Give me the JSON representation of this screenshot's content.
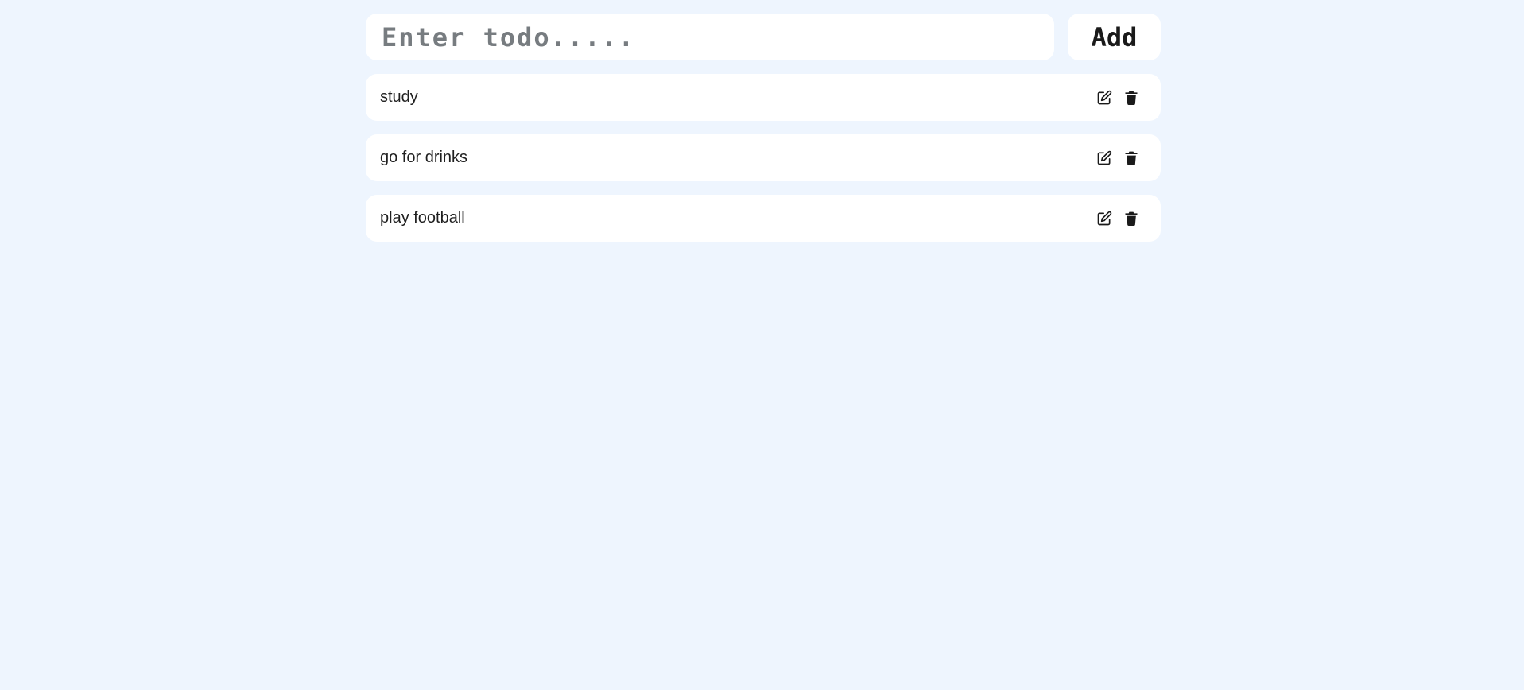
{
  "new_todo": {
    "placeholder": "Enter todo.....",
    "value": ""
  },
  "add_button": {
    "label": "Add"
  },
  "todos": [
    {
      "text": "study",
      "edit_icon": "edit-icon",
      "delete_icon": "trash-icon"
    },
    {
      "text": "go for drinks",
      "edit_icon": "edit-icon",
      "delete_icon": "trash-icon"
    },
    {
      "text": "play football",
      "edit_icon": "edit-icon",
      "delete_icon": "trash-icon"
    }
  ],
  "colors": {
    "background": "#eef5fe",
    "card": "#ffffff",
    "text": "#1f1f1f",
    "placeholder": "#777c80"
  }
}
